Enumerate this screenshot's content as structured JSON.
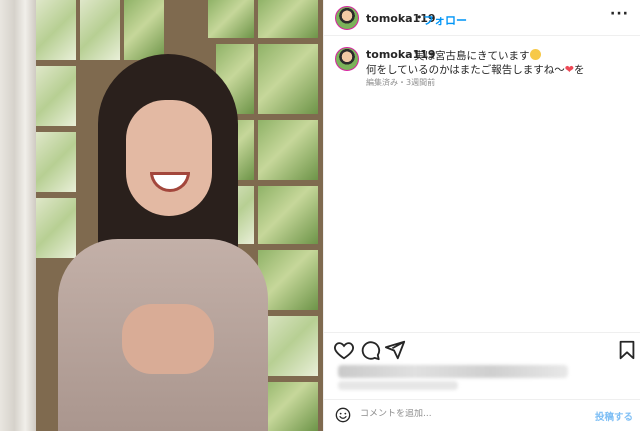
{
  "post": {
    "author": "tomoka119",
    "separator": "•",
    "follow_label": "フォロー",
    "more_label": "···",
    "caption_line1": "実は宮古島にきています",
    "caption_line2": "何をしているのかはまたご報告しますね〜",
    "caption_line2_end": "を",
    "edited_label": "編集済み",
    "meta_sep": "・",
    "time_ago": "3週間前"
  },
  "comment_bar": {
    "placeholder": "コメントを追加...",
    "post_label": "投稿する"
  },
  "icons": {
    "like": "heart-icon",
    "comment": "comment-icon",
    "share": "share-icon",
    "save": "bookmark-icon",
    "emoji": "smile-icon"
  },
  "colors": {
    "accent": "#0095f6",
    "post_disabled": "#7fbff5",
    "meta": "#8e8e8e"
  }
}
